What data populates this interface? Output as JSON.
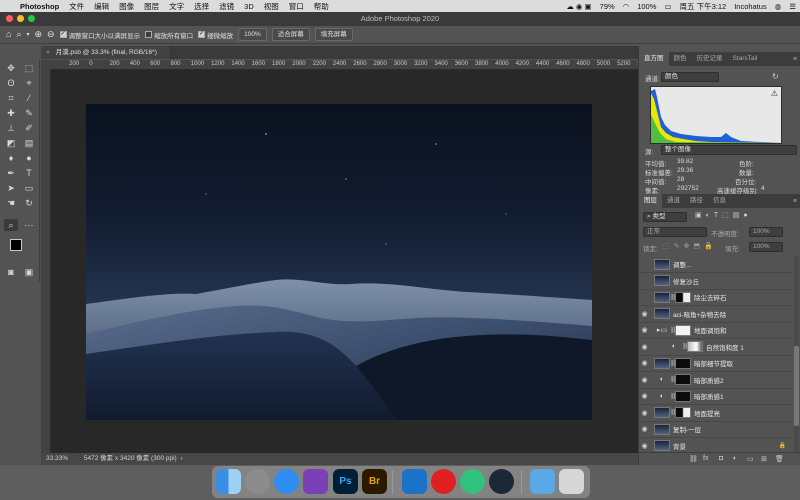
{
  "menubar": {
    "apple": "",
    "app": "Photoshop",
    "items": [
      "文件",
      "编辑",
      "图像",
      "图层",
      "文字",
      "选择",
      "滤镜",
      "3D",
      "视图",
      "窗口",
      "帮助"
    ],
    "battery": "79%",
    "battery2": "100%",
    "datetime": "周五 下午3:12",
    "user": "Incohatus"
  },
  "window": {
    "title": "Adobe Photoshop 2020"
  },
  "options": {
    "resize_windows": "调整窗口大小以满屏显示",
    "zoom_all": "缩放所有窗口",
    "scrubby_zoom": "细微缩放",
    "zoom_value": "100%",
    "fit_screen": "适合屏幕",
    "fill_screen": "填充屏幕"
  },
  "document": {
    "tab_title": "月漠.psb @ 33.3% (final, RGB/16*)",
    "zoom": "33.33%",
    "info": "5472 像素 x 3420 像素 (300 ppi)"
  },
  "ruler_h": [
    "200",
    "0",
    "200",
    "400",
    "600",
    "800",
    "1000",
    "1200",
    "1400",
    "1600",
    "1800",
    "2000",
    "2200",
    "2400",
    "2600",
    "2800",
    "3000",
    "3200",
    "3400",
    "3600",
    "3800",
    "4000",
    "4200",
    "4400",
    "4600",
    "4800",
    "5000",
    "5200",
    "5400",
    "5600"
  ],
  "histogram_panel": {
    "tabs": [
      "直方图",
      "颜色",
      "历史记录",
      "StarsTail"
    ],
    "channel_label": "通道:",
    "channel_value": "颜色",
    "source_label": "源:",
    "source_value": "整个图像",
    "stats": {
      "mean_label": "平均值:",
      "mean": "39.82",
      "std_label": "标准偏差:",
      "std": "29.36",
      "median_label": "中间值:",
      "median": "28",
      "pixels_label": "像素:",
      "pixels": "292752",
      "level_label": "色阶:",
      "count_label": "数量:",
      "percentile_label": "百分位:",
      "cache_label": "高速缓存级别:",
      "cache": "4"
    }
  },
  "layers_panel": {
    "tabs": [
      "图层",
      "通道",
      "路径",
      "信息"
    ],
    "filter_value": "类型",
    "blend_mode": "正常",
    "opacity_label": "不透明度:",
    "opacity_value": "100%",
    "lock_label": "锁定:",
    "fill_label": "填充:",
    "fill_value": "100%",
    "layers": [
      {
        "name": "调整...",
        "thumb": "photo",
        "mask": "",
        "visible": false,
        "indent": 0
      },
      {
        "name": "修复沙丘",
        "thumb": "photo",
        "mask": "",
        "visible": false,
        "indent": 0
      },
      {
        "name": "除尘去碎石",
        "thumb": "photo",
        "mask": "mixed",
        "visible": false,
        "indent": 0
      },
      {
        "name": "aci-暗角+杂物去除",
        "thumb": "photo",
        "mask": "",
        "visible": true,
        "indent": 0
      },
      {
        "name": "地面调饱和",
        "thumb": "folder",
        "mask": "white",
        "visible": true,
        "indent": 0
      },
      {
        "name": "自然饱和度 1",
        "thumb": "adj",
        "mask": "grad",
        "visible": true,
        "indent": 1
      },
      {
        "name": "暗部细节提取",
        "thumb": "photo",
        "mask": "black",
        "visible": true,
        "indent": 0
      },
      {
        "name": "暗部质感2",
        "thumb": "adj",
        "mask": "black",
        "visible": true,
        "indent": 0
      },
      {
        "name": "暗部质感1",
        "thumb": "adj",
        "mask": "black",
        "visible": true,
        "indent": 0
      },
      {
        "name": "地面提亮",
        "thumb": "photo",
        "mask": "mixed",
        "visible": true,
        "indent": 0
      },
      {
        "name": "复制-一层",
        "thumb": "photo",
        "mask": "",
        "visible": true,
        "indent": 0
      },
      {
        "name": "背景",
        "thumb": "photo",
        "mask": "",
        "visible": true,
        "indent": 0,
        "locked": true
      }
    ]
  },
  "dock": {
    "apps": [
      {
        "name": "finder-icon",
        "label": ""
      },
      {
        "name": "launchpad-icon",
        "label": ""
      },
      {
        "name": "safari-icon",
        "label": ""
      },
      {
        "name": "affinity-photo-icon",
        "label": ""
      },
      {
        "name": "photoshop-icon",
        "label": "Ps"
      },
      {
        "name": "bridge-icon",
        "label": "Br"
      },
      {
        "name": "affinity-designer-icon",
        "label": ""
      },
      {
        "name": "netease-music-icon",
        "label": ""
      },
      {
        "name": "qq-music-icon",
        "label": ""
      },
      {
        "name": "steam-icon",
        "label": ""
      },
      {
        "name": "downloads-folder-icon",
        "label": ""
      },
      {
        "name": "trash-icon",
        "label": ""
      }
    ]
  },
  "colors": {
    "panel_bg": "#535353",
    "canvas_bg": "#282828",
    "histogram_blue": "#1f5fd8",
    "histogram_yellow": "#e8e800",
    "photoshop_blue": "#31a8ff",
    "bridge_orange": "#e8a218"
  }
}
